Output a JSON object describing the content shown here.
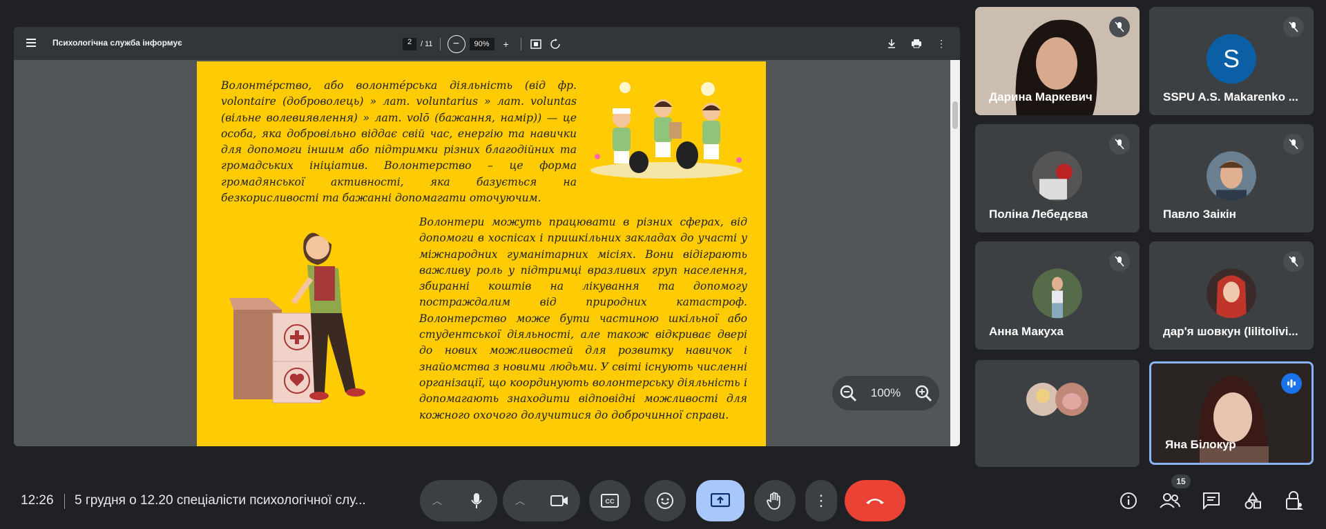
{
  "pdf": {
    "title": "Психологічна служба інформує",
    "page_current": "2",
    "page_total": "/ 11",
    "zoom": "90%"
  },
  "document": {
    "paragraph1": "Волонтéрство, або волонтéрська діяльність (від фр. volontaire (доброволець) » лат. voluntarius » лат. voluntas (вільне волевиявлення) » лат. volō (бажання, намір)) — це особа, яка добровільно віддає свій час, енергію та навички для допомоги іншим або підтримки різних благодійних та громадських ініціатив. Волонтерство – це форма громадянської активності, яка базується на безкорисливості та бажанні допомагати оточуючим.",
    "paragraph2": "Волонтери можуть працювати в різних сферах, від допомоги в хоспісах і пришкільних закладах до участі у міжнародних гуманітарних місіях. Вони відіграють важливу роль у підтримці вразливих груп населення, збиранні коштів на лікування та допомогу постраждалим від природних катастроф. Волонтерство може бути частиною шкільної або студентської діяльності, але також відкриває двері до нових можливостей для розвитку навичок і знайомства з новими людьми. У світі існують численні організації, що координують волонтерську діяльність і допомагають знаходити відповідні можливості для кожного охочого долучитися до доброчинної справи."
  },
  "viewer_zoom": "100%",
  "participants": [
    {
      "name": "Дарина Маркевич",
      "muted": true,
      "video": true
    },
    {
      "name": "SSPU A.S. Makarenko ...",
      "muted": true,
      "initial": "S"
    },
    {
      "name": "Поліна Лебедєва",
      "muted": true
    },
    {
      "name": "Павло Заікін",
      "muted": true
    },
    {
      "name": "Анна Макуха",
      "muted": true
    },
    {
      "name": "дар'я шовкун (lilitolivi...",
      "muted": true
    },
    {
      "name": "",
      "muted": false
    },
    {
      "name": "Яна Білокур",
      "speaking": true,
      "video": true
    }
  ],
  "bottom": {
    "time": "12:26",
    "meeting_title": "5 грудня о 12.20 спеціалісти психологічної слу...",
    "people_count": "15"
  },
  "colors": {
    "end_call": "#ea4335",
    "present_active": "#a8c7fa",
    "speaking_border": "#8ab4f8",
    "page_bg": "#ffcb05"
  }
}
